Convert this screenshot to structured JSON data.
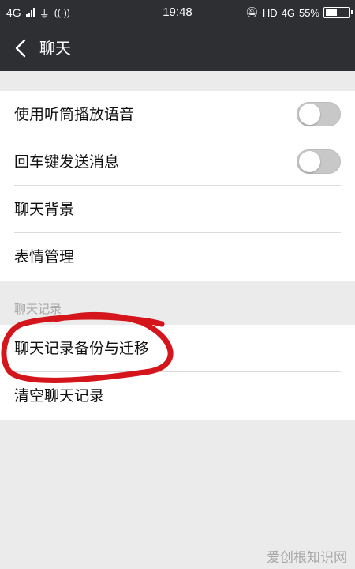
{
  "status_bar": {
    "network": "4G",
    "time": "19:48",
    "hd": "HD",
    "network_right": "4G",
    "battery_percent": "55%",
    "battery_level": 0.55,
    "icons": [
      "signal-icon",
      "usb-icon",
      "hotspot-icon",
      "mute-icon",
      "battery-icon"
    ]
  },
  "nav": {
    "back_icon": "chevron-left-icon",
    "title": "聊天"
  },
  "settings": {
    "items": [
      {
        "label": "使用听筒播放语音",
        "toggle": false
      },
      {
        "label": "回车键发送消息",
        "toggle": false
      },
      {
        "label": "聊天背景"
      },
      {
        "label": "表情管理"
      }
    ]
  },
  "chat_history": {
    "section_label": "聊天记录",
    "items": [
      {
        "label": "聊天记录备份与迁移"
      },
      {
        "label": "清空聊天记录"
      }
    ]
  },
  "watermark": "爱创根知识网",
  "colors": {
    "bar": "#2e2f33",
    "page_bg": "#ebebeb",
    "annotation": "#d4161c"
  }
}
